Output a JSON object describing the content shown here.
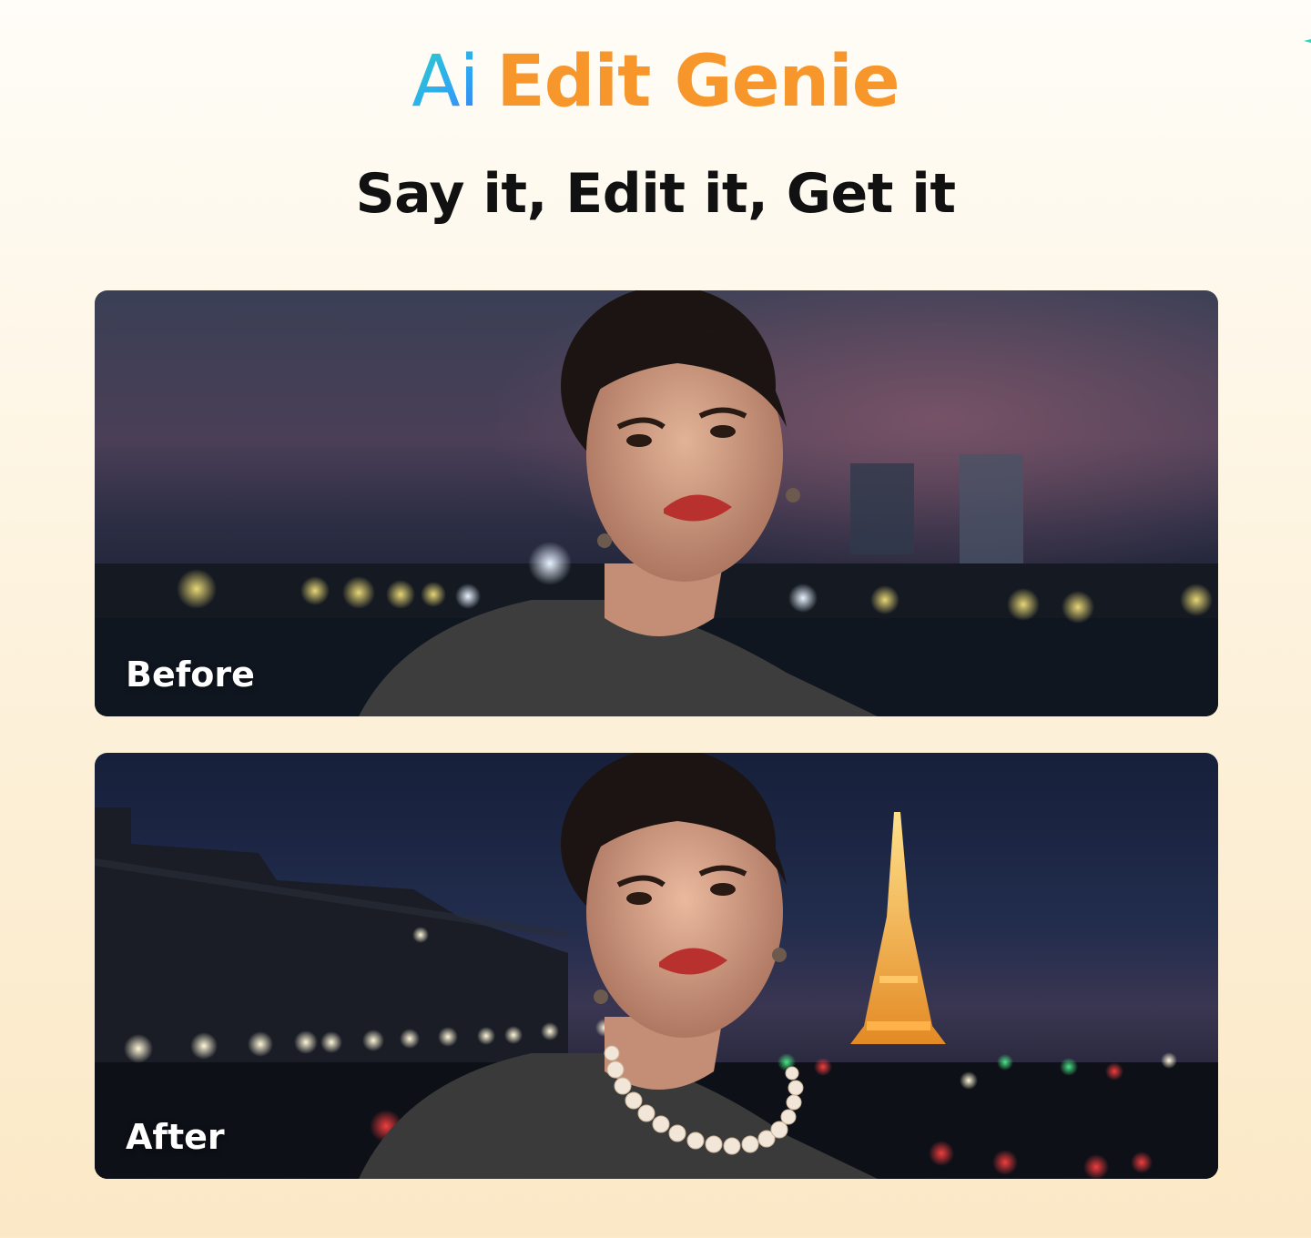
{
  "header": {
    "brand_ai": "Ai",
    "brand_rest": "Edit Genie",
    "tagline": "Say it, Edit it, Get it"
  },
  "panels": [
    {
      "label": "Before",
      "image": "portrait-woman-blurred-city-night"
    },
    {
      "label": "After",
      "image": "portrait-woman-eiffel-tower-pearl-necklace"
    }
  ],
  "colors": {
    "brand_orange": "#f7962a",
    "brand_blue": "#2ea6f3",
    "brand_teal": "#2fd3c3"
  }
}
